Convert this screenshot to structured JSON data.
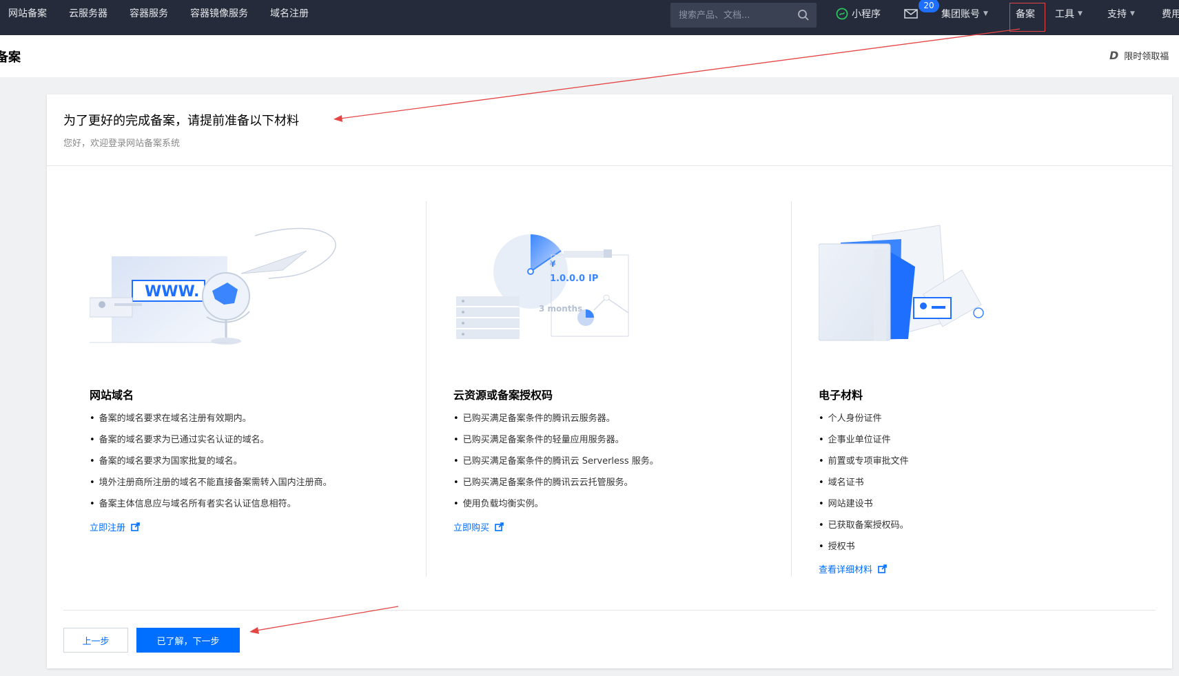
{
  "nav": {
    "links": [
      "网站备案",
      "云服务器",
      "容器服务",
      "容器镜像服务",
      "域名注册"
    ],
    "search_placeholder": "搜索产品、文档...",
    "miniprogram": "小程序",
    "mail_badge": "20",
    "account": "集团账号",
    "beian": "备案",
    "tools": "工具",
    "support": "支持",
    "fees": "费用"
  },
  "header": {
    "title": "备案",
    "promo": "限时领取福"
  },
  "card": {
    "title": "为了更好的完成备案，请提前准备以下材料",
    "subtitle": "您好，欢迎登录网站备案系统"
  },
  "sections": [
    {
      "title": "网站域名",
      "illus_text": "WWW.",
      "bullets": [
        "备案的域名要求在域名注册有效期内。",
        "备案的域名要求为已通过实名认证的域名。",
        "备案的域名要求为国家批复的域名。",
        "境外注册商所注册的域名不能直接备案需转入国内注册商。",
        "备案主体信息应与域名所有者实名认证信息相符。"
      ],
      "link": "立即注册"
    },
    {
      "title": "云资源或备案授权码",
      "illus_ip": "1.0.0.0",
      "illus_ip_label": "IP",
      "illus_months": "3 months",
      "illus_yen": "¥",
      "bullets": [
        "已购买满足备案条件的腾讯云服务器。",
        "已购买满足备案条件的轻量应用服务器。",
        "已购买满足备案条件的腾讯云 Serverless 服务。",
        "已购买满足备案条件的腾讯云云托管服务。",
        "使用负载均衡实例。"
      ],
      "link": "立即购买"
    },
    {
      "title": "电子材料",
      "bullets": [
        "个人身份证件",
        "企事业单位证件",
        "前置或专项审批文件",
        "域名证书",
        "网站建设书",
        "已获取备案授权码。",
        "授权书"
      ],
      "link": "查看详细材料"
    }
  ],
  "buttons": {
    "prev": "上一步",
    "next": "已了解，下一步"
  },
  "colors": {
    "nav_bg": "#252b3a",
    "accent": "#006eff",
    "annotation": "#e54545"
  }
}
